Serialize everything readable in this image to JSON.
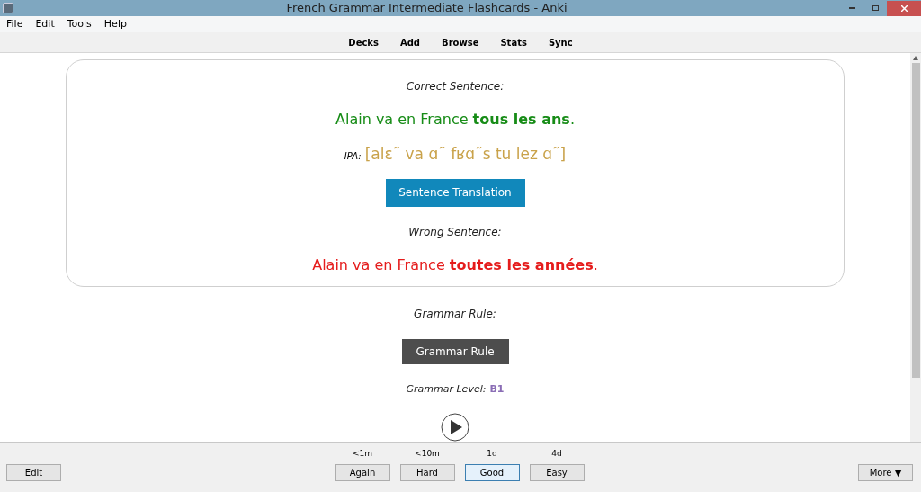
{
  "window": {
    "title": "French Grammar Intermediate Flashcards - Anki"
  },
  "menu": [
    "File",
    "Edit",
    "Tools",
    "Help"
  ],
  "toolbar": [
    "Decks",
    "Add",
    "Browse",
    "Stats",
    "Sync"
  ],
  "card": {
    "correct_label": "Correct Sentence:",
    "correct_sentence": "Alain va en France **tous les ans**.",
    "ipa_label": "IPA:",
    "ipa": "[alɛ˜ va ɑ˜ fʁɑ˜s tu lez ɑ˜]",
    "translation_button": "Sentence Translation",
    "wrong_label": "Wrong Sentence:",
    "wrong_sentence": "Alain va en France **toutes les années**."
  },
  "rule_label": "Grammar Rule:",
  "rule_button": "Grammar Rule",
  "level_label": "Grammar Level:",
  "level_value": "B1",
  "bottom": {
    "edit": "Edit",
    "more": "More ▼",
    "answers": [
      {
        "interval": "<1m",
        "label": "Again",
        "selected": false
      },
      {
        "interval": "<10m",
        "label": "Hard",
        "selected": false
      },
      {
        "interval": "1d",
        "label": "Good",
        "selected": true
      },
      {
        "interval": "4d",
        "label": "Easy",
        "selected": false
      }
    ]
  }
}
